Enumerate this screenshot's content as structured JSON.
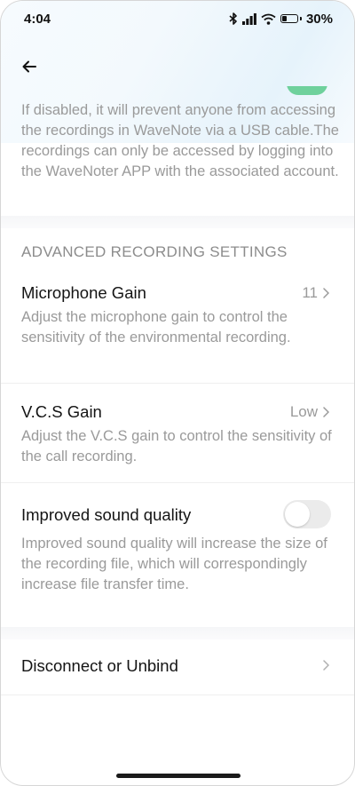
{
  "status_bar": {
    "time": "4:04",
    "battery": "30%",
    "battery_level": 0.3,
    "icons": [
      "bluetooth-icon",
      "signal-icon",
      "wifi-icon",
      "battery-icon"
    ]
  },
  "nav": {
    "back_icon": "arrow-left-icon"
  },
  "intro_text": "If disabled, it will prevent anyone from accessing the recordings in WaveNote via a USB cable.The recordings can only be accessed by logging into the WaveNoter APP with the associated account.",
  "section": {
    "title": "ADVANCED RECORDING SETTINGS"
  },
  "settings": {
    "mic_gain": {
      "title": "Microphone Gain",
      "value": "11",
      "description": "Adjust the microphone gain to control the sensitivity of the environmental recording."
    },
    "vcs_gain": {
      "title": "V.C.S Gain",
      "value": "Low",
      "description": "Adjust the V.C.S gain to control the sensitivity of the call recording."
    },
    "sound_quality": {
      "title": "Improved sound quality",
      "enabled": false,
      "description": "Improved sound quality will increase the size of the recording file, which will correspondingly increase file transfer time."
    }
  },
  "disconnect": {
    "title": "Disconnect or Unbind"
  },
  "colors": {
    "toggle_on": "#6fd19c",
    "toggle_off": "#ebebeb",
    "secondary_text": "#9a9a9a"
  }
}
